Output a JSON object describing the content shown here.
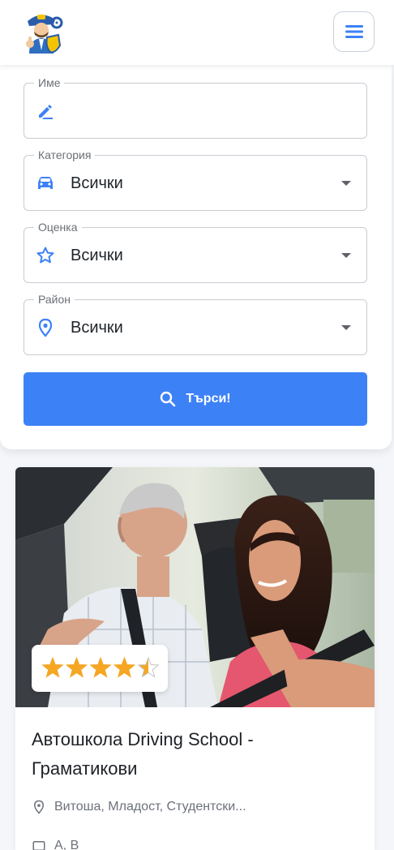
{
  "header": {
    "logo_icon": "driving-instructor-mascot-logo",
    "menu_icon": "hamburger-menu-icon"
  },
  "search": {
    "name_field": {
      "label": "Име",
      "icon": "pencil-icon",
      "value": ""
    },
    "category_field": {
      "label": "Категория",
      "icon": "car-icon",
      "value": "Всички"
    },
    "rating_field": {
      "label": "Оценка",
      "icon": "star-outline-icon",
      "value": "Всички"
    },
    "district_field": {
      "label": "Район",
      "icon": "location-pin-icon",
      "value": "Всички"
    },
    "submit_label": "Търси!",
    "submit_icon": "search-icon"
  },
  "card": {
    "photo_alt": "driving-lesson-photo",
    "rating": 4.5,
    "rating_max": 5,
    "title": "Автошкола Driving School - Граматикови",
    "location": "Витоша, Младост, Студентски...",
    "categories": "A, B"
  },
  "colors": {
    "accent": "#3d81f7",
    "star": "#f5a623",
    "icon_blue": "#3d81f7"
  }
}
